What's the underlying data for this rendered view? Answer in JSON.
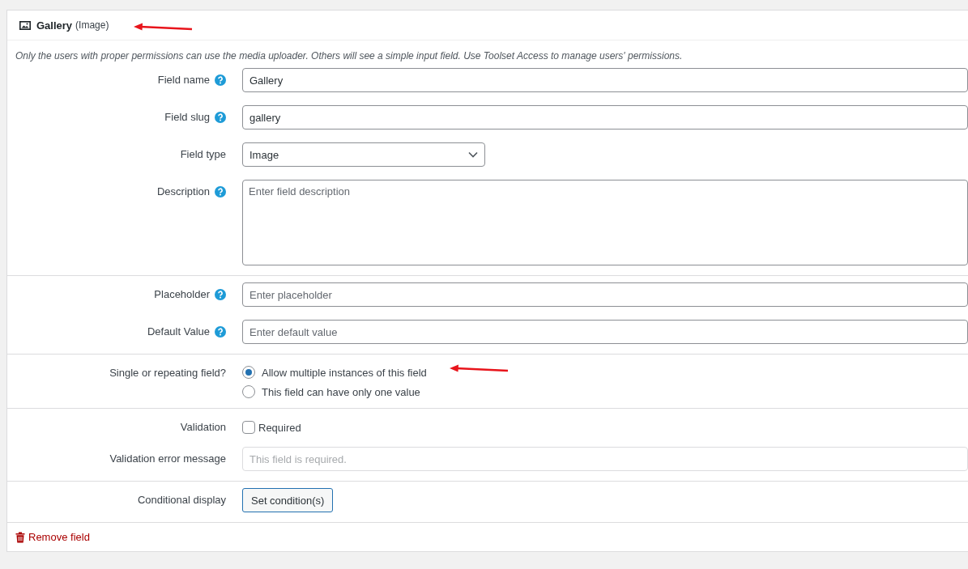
{
  "header": {
    "title": "Gallery",
    "type": "(Image)",
    "annotation_arrow": true
  },
  "notice": "Only the users with proper permissions can use the media uploader. Others will see a simple input field. Use Toolset Access to manage users' permissions.",
  "sections": [
    {
      "rows": [
        {
          "kind": "input",
          "label": "Field name",
          "help": true,
          "value": "Gallery"
        },
        {
          "kind": "input",
          "label": "Field slug",
          "help": true,
          "value": "gallery"
        },
        {
          "kind": "select",
          "label": "Field type",
          "help": false,
          "value": "Image"
        },
        {
          "kind": "textarea",
          "label": "Description",
          "help": true,
          "placeholder": "Enter field description"
        }
      ]
    },
    {
      "rows": [
        {
          "kind": "input",
          "label": "Placeholder",
          "help": true,
          "placeholder": "Enter placeholder"
        },
        {
          "kind": "input",
          "label": "Default Value",
          "help": true,
          "placeholder": "Enter default value"
        }
      ]
    },
    {
      "rows": [
        {
          "kind": "radio",
          "label": "Single or repeating field?",
          "help": false,
          "options": [
            {
              "label": "Allow multiple instances of this field",
              "selected": true,
              "annotation_arrow": true
            },
            {
              "label": "This field can have only one value",
              "selected": false,
              "annotation_arrow": false
            }
          ]
        }
      ]
    },
    {
      "rows": [
        {
          "kind": "checkbox",
          "label": "Validation",
          "help": false,
          "text": "Required",
          "checked": false
        },
        {
          "kind": "input",
          "label": "Validation error message",
          "help": false,
          "placeholder": "This field is required.",
          "disabled": true
        }
      ]
    },
    {
      "rows": [
        {
          "kind": "button",
          "label": "Conditional display",
          "help": false,
          "text": "Set condition(s)"
        }
      ]
    }
  ],
  "remove_link": "Remove field"
}
